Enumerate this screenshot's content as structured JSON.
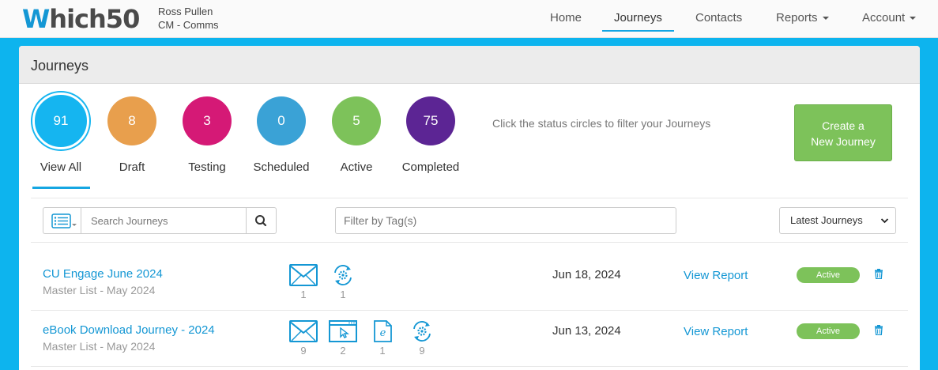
{
  "brand": {
    "logo_w": "W",
    "logo_rest": "hich50"
  },
  "user": {
    "name": "Ross Pullen",
    "org": "CM - Comms"
  },
  "nav": {
    "home": "Home",
    "journeys": "Journeys",
    "contacts": "Contacts",
    "reports": "Reports",
    "account": "Account"
  },
  "panel": {
    "title": "Journeys"
  },
  "statuses": [
    {
      "count": "91",
      "label": "View All",
      "color": "#15b5f0"
    },
    {
      "count": "8",
      "label": "Draft",
      "color": "#e89f4d"
    },
    {
      "count": "3",
      "label": "Testing",
      "color": "#d51976"
    },
    {
      "count": "0",
      "label": "Scheduled",
      "color": "#3aa2d6"
    },
    {
      "count": "5",
      "label": "Active",
      "color": "#7dc25a"
    },
    {
      "count": "75",
      "label": "Completed",
      "color": "#5c2594"
    }
  ],
  "hint": "Click the status circles to filter your Journeys",
  "create_button": {
    "line1": "Create a",
    "line2": "New Journey"
  },
  "filters": {
    "search_placeholder": "Search Journeys",
    "tag_placeholder": "Filter by Tag(s)",
    "sort_selected": "Latest Journeys"
  },
  "journeys": [
    {
      "name": "CU Engage June 2024",
      "list": "Master List - May 2024",
      "steps": [
        {
          "icon": "email-icon",
          "count": "1"
        },
        {
          "icon": "cycle-gear-icon",
          "count": "1"
        }
      ],
      "date": "Jun 18, 2024",
      "report": "View Report",
      "status": "Active"
    },
    {
      "name": "eBook Download Journey - 2024",
      "list": "Master List - May 2024",
      "steps": [
        {
          "icon": "email-icon",
          "count": "9"
        },
        {
          "icon": "webpage-icon",
          "count": "2"
        },
        {
          "icon": "ebook-icon",
          "count": "1"
        },
        {
          "icon": "cycle-gear-icon",
          "count": "9"
        }
      ],
      "date": "Jun 13, 2024",
      "report": "View Report",
      "status": "Active"
    }
  ]
}
